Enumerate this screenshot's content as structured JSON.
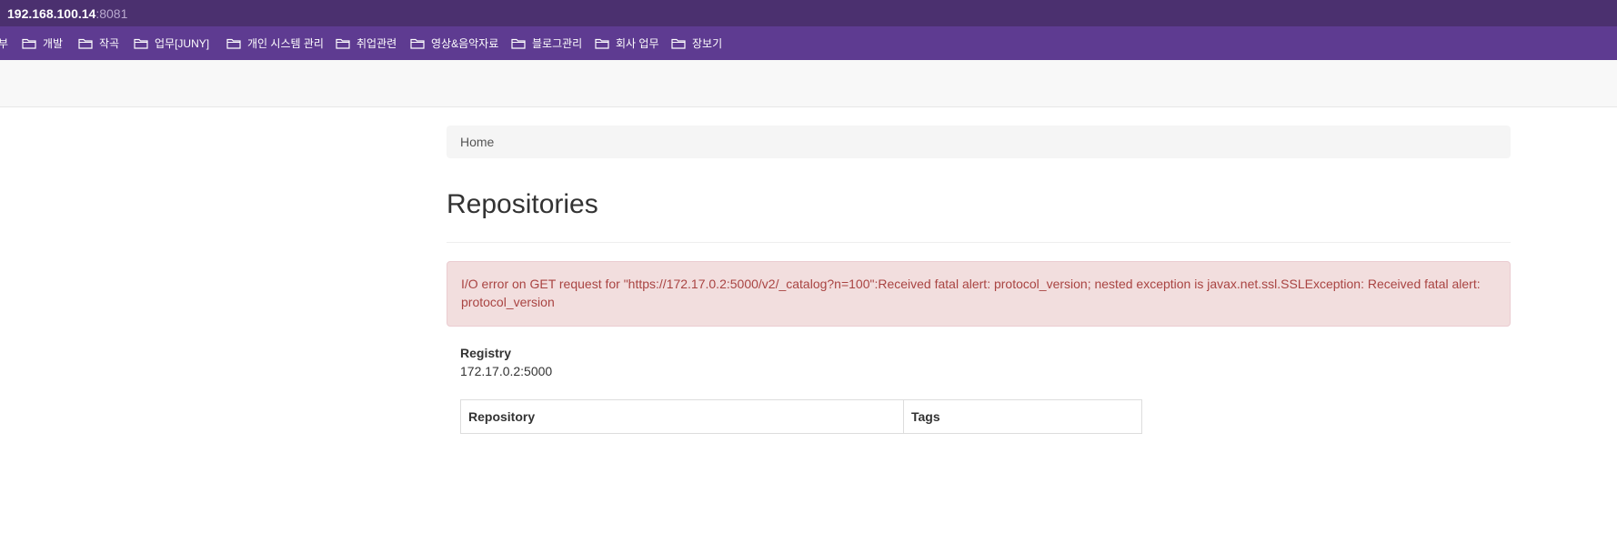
{
  "browser": {
    "host": "192.168.100.14",
    "port": ":8081",
    "bookmarks": [
      {
        "label": "부"
      },
      {
        "label": "개발"
      },
      {
        "label": "작곡"
      },
      {
        "label": "업무[JUNY]"
      },
      {
        "label": "개인 시스템 관리"
      },
      {
        "label": "취업관련"
      },
      {
        "label": "영상&음악자료"
      },
      {
        "label": "블로그관리"
      },
      {
        "label": "회사 업무"
      },
      {
        "label": "장보기"
      }
    ]
  },
  "breadcrumb": {
    "home": "Home"
  },
  "page": {
    "title": "Repositories"
  },
  "alert": {
    "message": "I/O error on GET request for \"https://172.17.0.2:5000/v2/_catalog?n=100\":Received fatal alert: protocol_version; nested exception is javax.net.ssl.SSLException: Received fatal alert: protocol_version"
  },
  "registry": {
    "label": "Registry",
    "value": "172.17.0.2:5000"
  },
  "table": {
    "columns": [
      "Repository",
      "Tags"
    ]
  },
  "colors": {
    "address_bar": "#4b306f",
    "bookmark_bar": "#5e3b91",
    "alert_bg": "#f2dede",
    "alert_text": "#a94442"
  }
}
